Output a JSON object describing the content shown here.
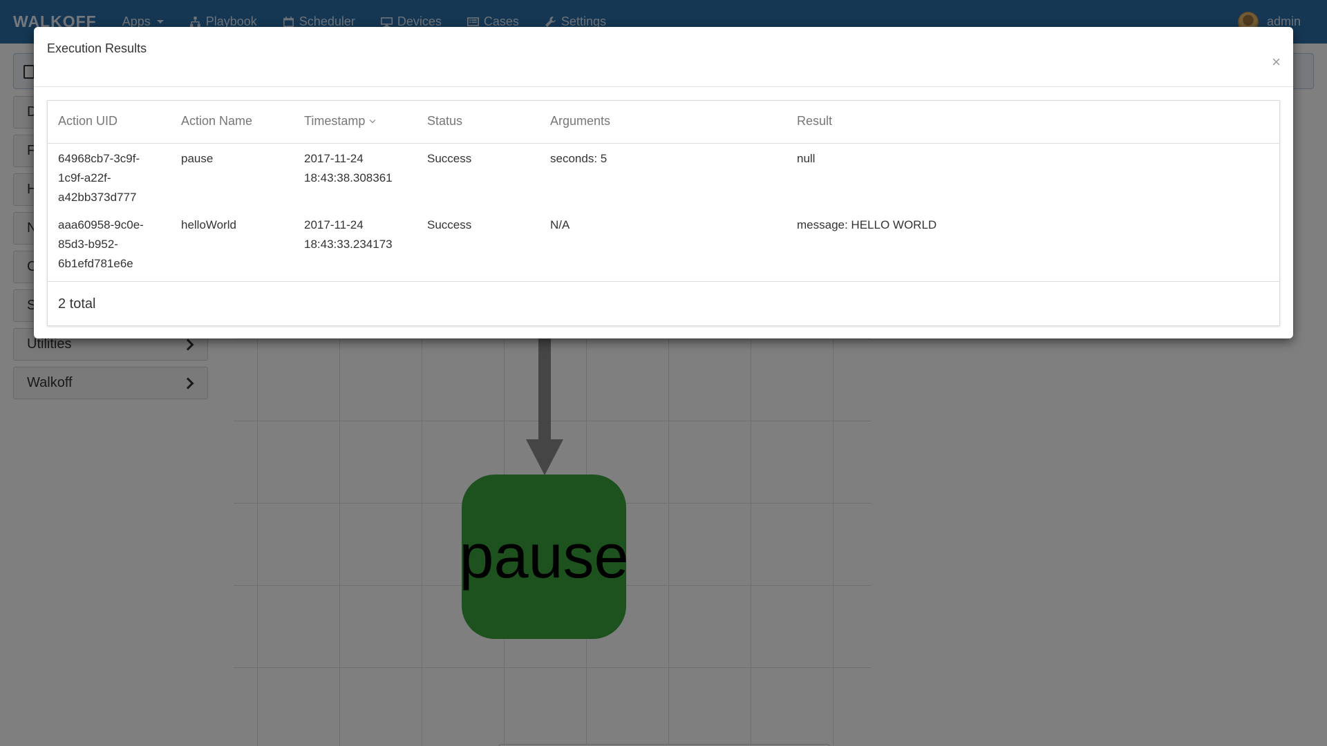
{
  "navbar": {
    "brand": "WALKOFF",
    "items": [
      {
        "label": "Apps",
        "icon": "caret-down-icon"
      },
      {
        "label": "Playbook",
        "icon": "sitemap-icon"
      },
      {
        "label": "Scheduler",
        "icon": "calendar-icon"
      },
      {
        "label": "Devices",
        "icon": "desktop-icon"
      },
      {
        "label": "Cases",
        "icon": "list-alt-icon"
      },
      {
        "label": "Settings",
        "icon": "wrench-icon"
      }
    ],
    "user": "admin"
  },
  "sidebar": {
    "items": [
      {
        "label": "D"
      },
      {
        "label": "F"
      },
      {
        "label": "H"
      },
      {
        "label": "N"
      },
      {
        "label": "C"
      },
      {
        "label": "S"
      },
      {
        "label": "Utilities"
      },
      {
        "label": "Walkoff"
      }
    ]
  },
  "graph": {
    "node_label": "pause",
    "node_color": "#3ba43c"
  },
  "modal": {
    "title": "Execution Results",
    "close": "×",
    "columns": {
      "uid": "Action UID",
      "name": "Action Name",
      "timestamp": "Timestamp",
      "status": "Status",
      "arguments": "Arguments",
      "result": "Result"
    },
    "rows": [
      {
        "uid_1": "64968cb7-3c9f-",
        "uid_2": "1c9f-a22f-",
        "uid_3": "a42bb373d777",
        "name": "pause",
        "date": "2017-11-24",
        "time": "18:43:38.308361",
        "status": "Success",
        "arguments": "seconds: 5",
        "result": "null"
      },
      {
        "uid_1": "aaa60958-9c0e-",
        "uid_2": "85d3-b952-",
        "uid_3": "6b1efd781e6e",
        "name": "helloWorld",
        "date": "2017-11-24",
        "time": "18:43:33.234173",
        "status": "Success",
        "arguments": "N/A",
        "result": "message: HELLO WORLD"
      }
    ],
    "footer": "2 total"
  }
}
